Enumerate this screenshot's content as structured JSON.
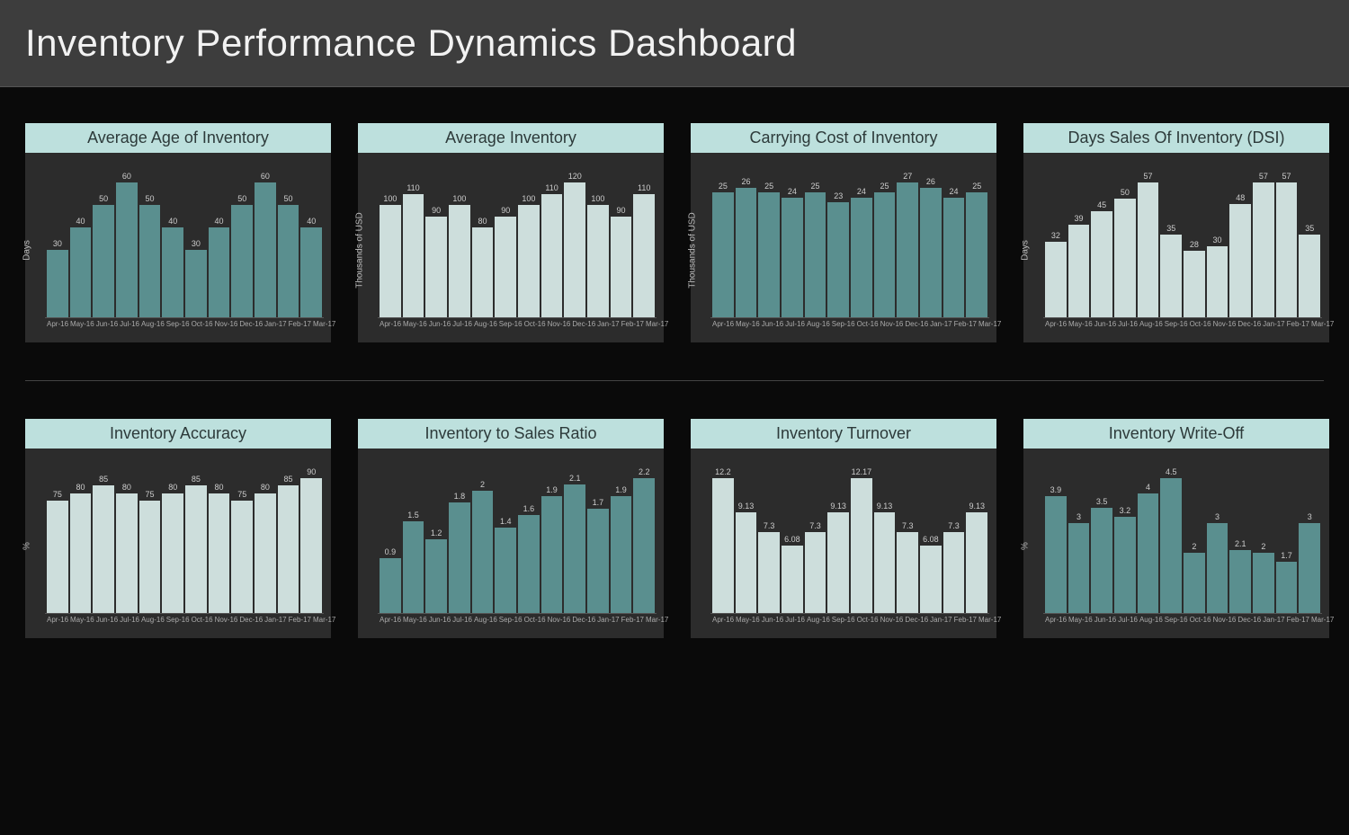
{
  "title": "Inventory Performance Dynamics Dashboard",
  "categories": [
    "Apr-16",
    "May-16",
    "Jun-16",
    "Jul-16",
    "Aug-16",
    "Sep-16",
    "Oct-16",
    "Nov-16",
    "Dec-16",
    "Jan-17",
    "Feb-17",
    "Mar-17"
  ],
  "colors": {
    "teal": "#5a8f8f",
    "light": "#cddedc",
    "title_bg": "#bde0dd"
  },
  "chart_data": [
    {
      "id": "avg-age",
      "title": "Average Age of Inventory",
      "type": "bar",
      "ylabel": "Days",
      "color": "teal",
      "categories": [
        "Apr-16",
        "May-16",
        "Jun-16",
        "Jul-16",
        "Aug-16",
        "Sep-16",
        "Oct-16",
        "Nov-16",
        "Dec-16",
        "Jan-17",
        "Feb-17",
        "Mar-17"
      ],
      "values": [
        30,
        40,
        50,
        60,
        50,
        40,
        30,
        40,
        50,
        60,
        50,
        40
      ]
    },
    {
      "id": "avg-inv",
      "title": "Average Inventory",
      "type": "bar",
      "ylabel": "Thousands of USD",
      "color": "light",
      "categories": [
        "Apr-16",
        "May-16",
        "Jun-16",
        "Jul-16",
        "Aug-16",
        "Sep-16",
        "Oct-16",
        "Nov-16",
        "Dec-16",
        "Jan-17",
        "Feb-17",
        "Mar-17"
      ],
      "values": [
        100,
        110,
        90,
        100,
        80,
        90,
        100,
        110,
        120,
        100,
        90,
        110
      ]
    },
    {
      "id": "carrying-cost",
      "title": "Carrying Cost of Inventory",
      "type": "bar",
      "ylabel": "Thousands of USD",
      "color": "teal",
      "categories": [
        "Apr-16",
        "May-16",
        "Jun-16",
        "Jul-16",
        "Aug-16",
        "Sep-16",
        "Oct-16",
        "Nov-16",
        "Dec-16",
        "Jan-17",
        "Feb-17",
        "Mar-17"
      ],
      "values": [
        25,
        26,
        25,
        24,
        25,
        23,
        24,
        25,
        27,
        26,
        24,
        25
      ]
    },
    {
      "id": "dsi",
      "title": "Days Sales Of Inventory (DSI)",
      "type": "bar",
      "ylabel": "Days",
      "color": "light",
      "categories": [
        "Apr-16",
        "May-16",
        "Jun-16",
        "Jul-16",
        "Aug-16",
        "Sep-16",
        "Oct-16",
        "Nov-16",
        "Dec-16",
        "Jan-17",
        "Feb-17",
        "Mar-17"
      ],
      "values": [
        32,
        39,
        45,
        50,
        57,
        35,
        28,
        30,
        48,
        57,
        57,
        35
      ]
    },
    {
      "id": "accuracy",
      "title": "Inventory Accuracy",
      "type": "bar",
      "ylabel": "%",
      "color": "light",
      "categories": [
        "Apr-16",
        "May-16",
        "Jun-16",
        "Jul-16",
        "Aug-16",
        "Sep-16",
        "Oct-16",
        "Nov-16",
        "Dec-16",
        "Jan-17",
        "Feb-17",
        "Mar-17"
      ],
      "values": [
        75,
        80,
        85,
        80,
        75,
        80,
        85,
        80,
        75,
        80,
        85,
        90
      ]
    },
    {
      "id": "inv-sales-ratio",
      "title": "Inventory to Sales Ratio",
      "type": "bar",
      "ylabel": "",
      "color": "teal",
      "categories": [
        "Apr-16",
        "May-16",
        "Jun-16",
        "Jul-16",
        "Aug-16",
        "Sep-16",
        "Oct-16",
        "Nov-16",
        "Dec-16",
        "Jan-17",
        "Feb-17",
        "Mar-17"
      ],
      "values": [
        0.9,
        1.5,
        1.2,
        1.8,
        2,
        1.4,
        1.6,
        1.9,
        2.1,
        1.7,
        1.9,
        2.2
      ]
    },
    {
      "id": "turnover",
      "title": "Inventory Turnover",
      "type": "bar",
      "ylabel": "",
      "color": "light",
      "categories": [
        "Apr-16",
        "May-16",
        "Jun-16",
        "Jul-16",
        "Aug-16",
        "Sep-16",
        "Oct-16",
        "Nov-16",
        "Dec-16",
        "Jan-17",
        "Feb-17",
        "Mar-17"
      ],
      "values": [
        12.2,
        9.13,
        7.3,
        6.08,
        7.3,
        9.13,
        12.17,
        9.13,
        7.3,
        6.08,
        7.3,
        9.13
      ]
    },
    {
      "id": "write-off",
      "title": "Inventory Write-Off",
      "type": "bar",
      "ylabel": "%",
      "color": "teal",
      "categories": [
        "Apr-16",
        "May-16",
        "Jun-16",
        "Jul-16",
        "Aug-16",
        "Sep-16",
        "Oct-16",
        "Nov-16",
        "Dec-16",
        "Jan-17",
        "Feb-17",
        "Mar-17"
      ],
      "values": [
        3.9,
        3,
        3.5,
        3.2,
        4,
        4.5,
        2,
        3,
        2.1,
        2,
        1.7,
        3
      ]
    }
  ]
}
